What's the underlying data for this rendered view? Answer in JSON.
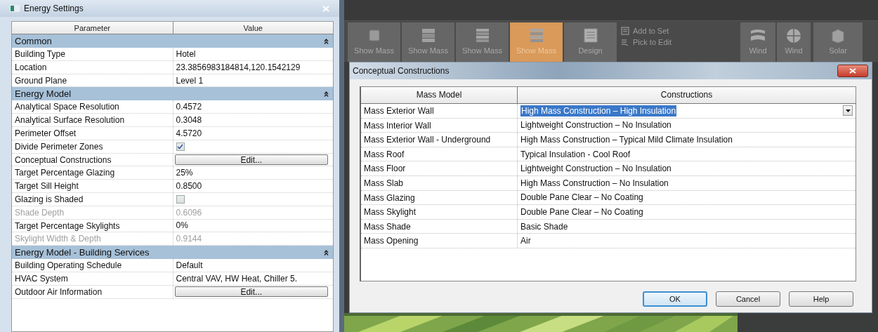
{
  "energy_settings": {
    "title": "Energy Settings",
    "columns": [
      "Parameter",
      "Value"
    ],
    "sections": [
      {
        "title": "Common",
        "expanded": true,
        "rows": [
          {
            "kind": "text",
            "name": "Building Type",
            "value": "Hotel",
            "disabled": false
          },
          {
            "kind": "text",
            "name": "Location",
            "value": "23.3856983184814,120.1542129",
            "disabled": false
          },
          {
            "kind": "text",
            "name": "Ground Plane",
            "value": "Level 1",
            "disabled": false
          }
        ]
      },
      {
        "title": "Energy Model",
        "expanded": true,
        "rows": [
          {
            "kind": "text",
            "name": "Analytical Space Resolution",
            "value": "0.4572",
            "disabled": false
          },
          {
            "kind": "text",
            "name": "Analytical Surface Resolution",
            "value": "0.3048",
            "disabled": false
          },
          {
            "kind": "text",
            "name": "Perimeter Offset",
            "value": "4.5720",
            "disabled": false
          },
          {
            "kind": "checkbox",
            "name": "Divide Perimeter Zones",
            "checked": true,
            "disabled": false
          },
          {
            "kind": "button",
            "name": "Conceptual Constructions",
            "value": "Edit...",
            "disabled": false
          },
          {
            "kind": "text",
            "name": "Target Percentage Glazing",
            "value": "25%",
            "disabled": false
          },
          {
            "kind": "text",
            "name": "Target Sill Height",
            "value": "0.8500",
            "disabled": false
          },
          {
            "kind": "checkbox",
            "name": "Glazing is Shaded",
            "checked": false,
            "disabled": false
          },
          {
            "kind": "text",
            "name": "Shade Depth",
            "value": "0.6096",
            "disabled": true
          },
          {
            "kind": "text",
            "name": "Target Percentage Skylights",
            "value": "0%",
            "disabled": false
          },
          {
            "kind": "text",
            "name": "Skylight Width & Depth",
            "value": "0.9144",
            "disabled": true
          }
        ]
      },
      {
        "title": "Energy Model - Building Services",
        "expanded": true,
        "rows": [
          {
            "kind": "text",
            "name": "Building Operating Schedule",
            "value": "Default",
            "disabled": false
          },
          {
            "kind": "text",
            "name": "HVAC System",
            "value": "Central VAV, HW Heat, Chiller 5.",
            "disabled": false
          },
          {
            "kind": "button",
            "name": "Outdoor Air Information",
            "value": "Edit...",
            "disabled": false
          }
        ]
      }
    ]
  },
  "ribbon": {
    "items": [
      {
        "kind": "large",
        "label": "Show Mass",
        "selected": false
      },
      {
        "kind": "large",
        "label": "Show Mass",
        "selected": false
      },
      {
        "kind": "large",
        "label": "Show Mass",
        "selected": false
      },
      {
        "kind": "large",
        "label": "Show Mass",
        "selected": true
      },
      {
        "kind": "large",
        "label": "Design",
        "selected": false
      },
      {
        "kind": "stack",
        "items": [
          {
            "label": "Add to Set"
          },
          {
            "label": "Pick to Edit"
          }
        ]
      },
      {
        "kind": "large",
        "label": "Wind",
        "selected": false
      },
      {
        "kind": "large",
        "label": "Wind",
        "selected": false
      },
      {
        "kind": "large",
        "label": "Solar",
        "selected": false
      }
    ]
  },
  "dialog": {
    "title": "Conceptual Constructions",
    "columns": [
      "Mass Model",
      "Constructions"
    ],
    "rows": [
      {
        "name": "Mass Exterior Wall",
        "value": "High Mass Construction – High Insulation",
        "selected": true
      },
      {
        "name": "Mass Interior Wall",
        "value": "Lightweight Construction – No Insulation",
        "selected": false
      },
      {
        "name": "Mass Exterior Wall - Underground",
        "value": "High Mass Construction – Typical Mild Climate Insulation",
        "selected": false
      },
      {
        "name": "Mass Roof",
        "value": "Typical Insulation - Cool Roof",
        "selected": false
      },
      {
        "name": "Mass Floor",
        "value": "Lightweight Construction – No Insulation",
        "selected": false
      },
      {
        "name": "Mass Slab",
        "value": "High Mass Construction – No Insulation",
        "selected": false
      },
      {
        "name": "Mass Glazing",
        "value": "Double Pane Clear – No Coating",
        "selected": false
      },
      {
        "name": "Mass Skylight",
        "value": "Double Pane Clear – No Coating",
        "selected": false
      },
      {
        "name": "Mass Shade",
        "value": "Basic Shade",
        "selected": false
      },
      {
        "name": "Mass Opening",
        "value": "Air",
        "selected": false
      }
    ],
    "buttons": [
      {
        "label": "OK",
        "default": true
      },
      {
        "label": "Cancel",
        "default": false
      },
      {
        "label": "Help",
        "default": false
      }
    ]
  }
}
